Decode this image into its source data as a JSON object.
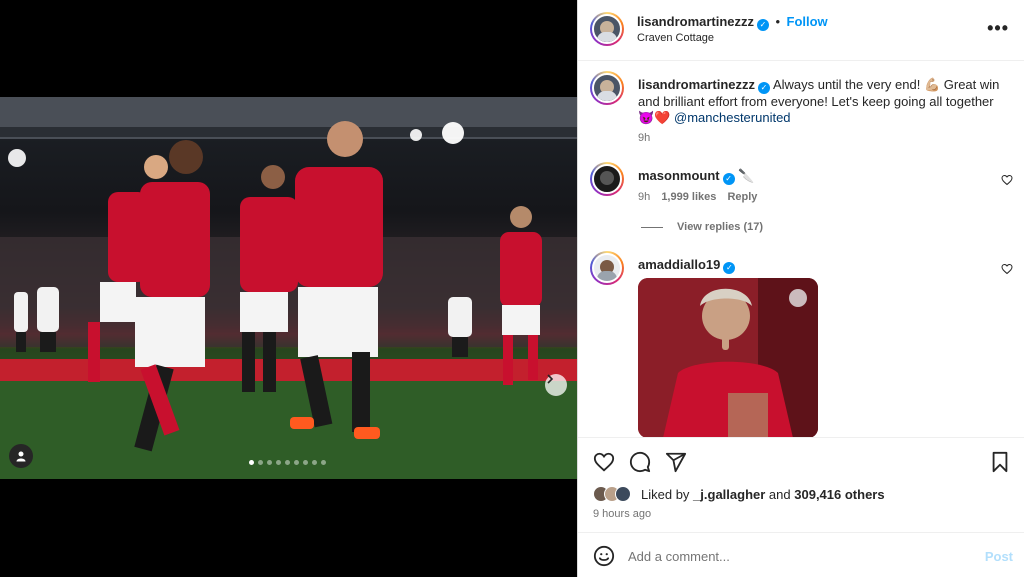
{
  "post": {
    "author": "lisandromartinezzz",
    "follow_label": "Follow",
    "location": "Craven Cottage",
    "more_label": "•••"
  },
  "caption": {
    "username": "lisandromartinezzz",
    "text_line1": "Always until the very end! 💪🏼 Great win",
    "text_line2": "and brilliant effort from everyone! Let's keep going all together",
    "text_line3_emoji": "😈❤️",
    "mention": "@manchesterunited",
    "time": "9h"
  },
  "comments": [
    {
      "username": "masonmount",
      "text": "🔪",
      "time": "9h",
      "likes": "1,999 likes",
      "reply_label": "Reply",
      "view_replies": "View replies (17)"
    },
    {
      "username": "amaddiallo19",
      "text": ""
    }
  ],
  "carousel": {
    "total": 9,
    "active": 0
  },
  "stats": {
    "liked_by_prefix": "Liked by",
    "liked_by_user": "_j.gallagher",
    "and_label": "and",
    "others": "309,416 others",
    "ago": "9 hours ago"
  },
  "add_comment": {
    "placeholder": "Add a comment...",
    "post_label": "Post"
  },
  "colors": {
    "accent": "#0095f6",
    "text": "#262626",
    "muted": "#737373",
    "post_disabled": "#b2dffc",
    "united_red": "#c8102e"
  }
}
